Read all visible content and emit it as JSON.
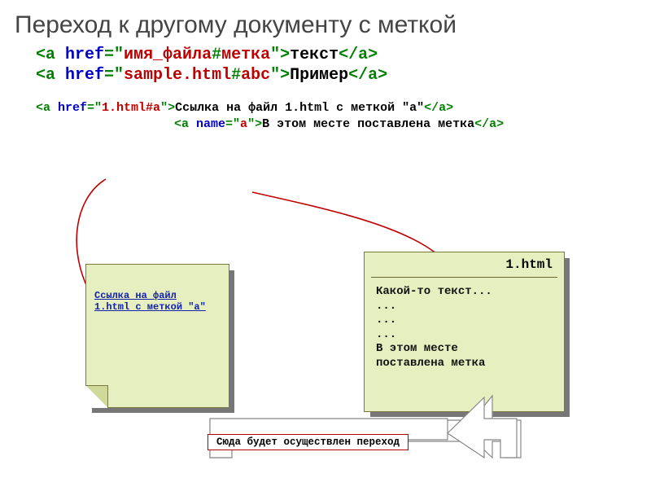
{
  "title": "Переход к другому документу с меткой",
  "code1": {
    "open1": "<a ",
    "attr1": "href",
    "eq": "=\"",
    "val_file": "имя_файла",
    "hash": "#",
    "val_mark": "метка",
    "close_q": "\">",
    "text1": "текст",
    "close1": "</a>",
    "val_file2": "sample.html",
    "val_mark2": "abc",
    "text2": "Пример"
  },
  "code2": {
    "val": "1.html#a",
    "text1": "Ссылка на файл 1.html с меткой \"a\"",
    "name_val": "a",
    "text2": "В этом месте поставлена метка"
  },
  "doc1": {
    "link_text": "Ссылка на файл 1.html с меткой \"a\""
  },
  "doc2": {
    "title": "1.html",
    "body": "Какой-то текст...\n...\n...\n...\nВ этом месте\nпоставлена метка"
  },
  "caption": "Сюда будет осуществлен переход"
}
